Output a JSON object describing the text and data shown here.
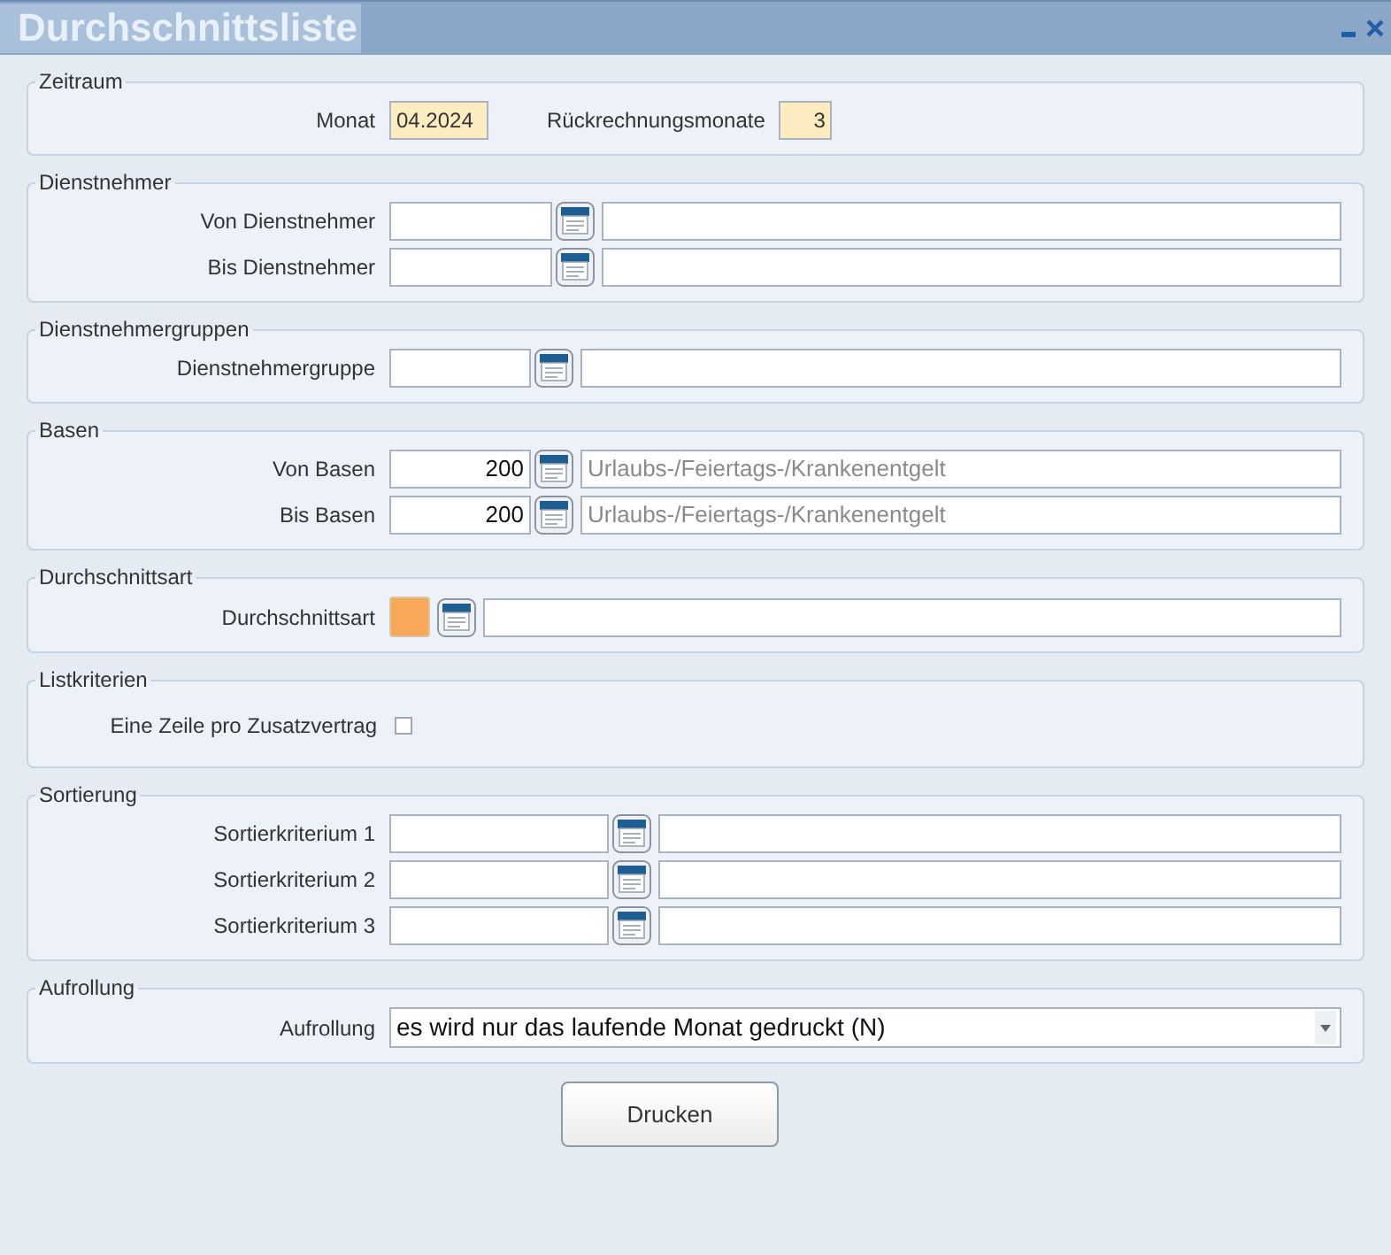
{
  "window": {
    "title": "Durchschnittsliste"
  },
  "sections": [
    {
      "title": "Zeitraum",
      "rows": [
        {
          "kind": "pair",
          "fields": [
            {
              "label": "Monat",
              "value": "04.2024",
              "required": true
            },
            {
              "label": "Rückrechnungsmonate",
              "value": "3",
              "required": true
            }
          ]
        }
      ]
    },
    {
      "title": "Dienstnehmer",
      "rows": [
        {
          "kind": "lookup-medium",
          "label": "Von Dienstnehmer"
        },
        {
          "kind": "lookup-medium",
          "label": "Bis Dienstnehmer"
        }
      ]
    },
    {
      "title": "Dienstnehmergruppen",
      "rows": [
        {
          "kind": "lookup-small",
          "label": "Dienstnehmergruppe"
        }
      ]
    },
    {
      "title": "Basen",
      "rows": [
        {
          "kind": "lookup-small",
          "label": "Von Basen",
          "code": "200",
          "description": "Urlaubs-/Feiertags-/Krankenentgelt"
        },
        {
          "kind": "lookup-small",
          "label": "Bis Basen",
          "code": "200",
          "description": "Urlaubs-/Feiertags-/Krankenentgelt"
        }
      ]
    },
    {
      "title": "Durchschnittsart",
      "rows": [
        {
          "kind": "color",
          "label": "Durchschnittsart",
          "color": "#f9a85a"
        }
      ]
    },
    {
      "title": "Listkriterien",
      "rows": [
        {
          "kind": "checkbox",
          "label": "Eine Zeile pro Zusatzvertrag",
          "checked": false
        }
      ]
    },
    {
      "title": "Sortierung",
      "rows": [
        {
          "kind": "lookup-large",
          "label": "Sortierkriterium 1"
        },
        {
          "kind": "lookup-large",
          "label": "Sortierkriterium 2"
        },
        {
          "kind": "lookup-large",
          "label": "Sortierkriterium 3"
        }
      ]
    },
    {
      "title": "Aufrollung",
      "rows": [
        {
          "kind": "select",
          "label": "Aufrollung",
          "value": "es wird nur das laufende Monat gedruckt (N)"
        }
      ]
    }
  ],
  "buttons": [
    "Drucken"
  ]
}
